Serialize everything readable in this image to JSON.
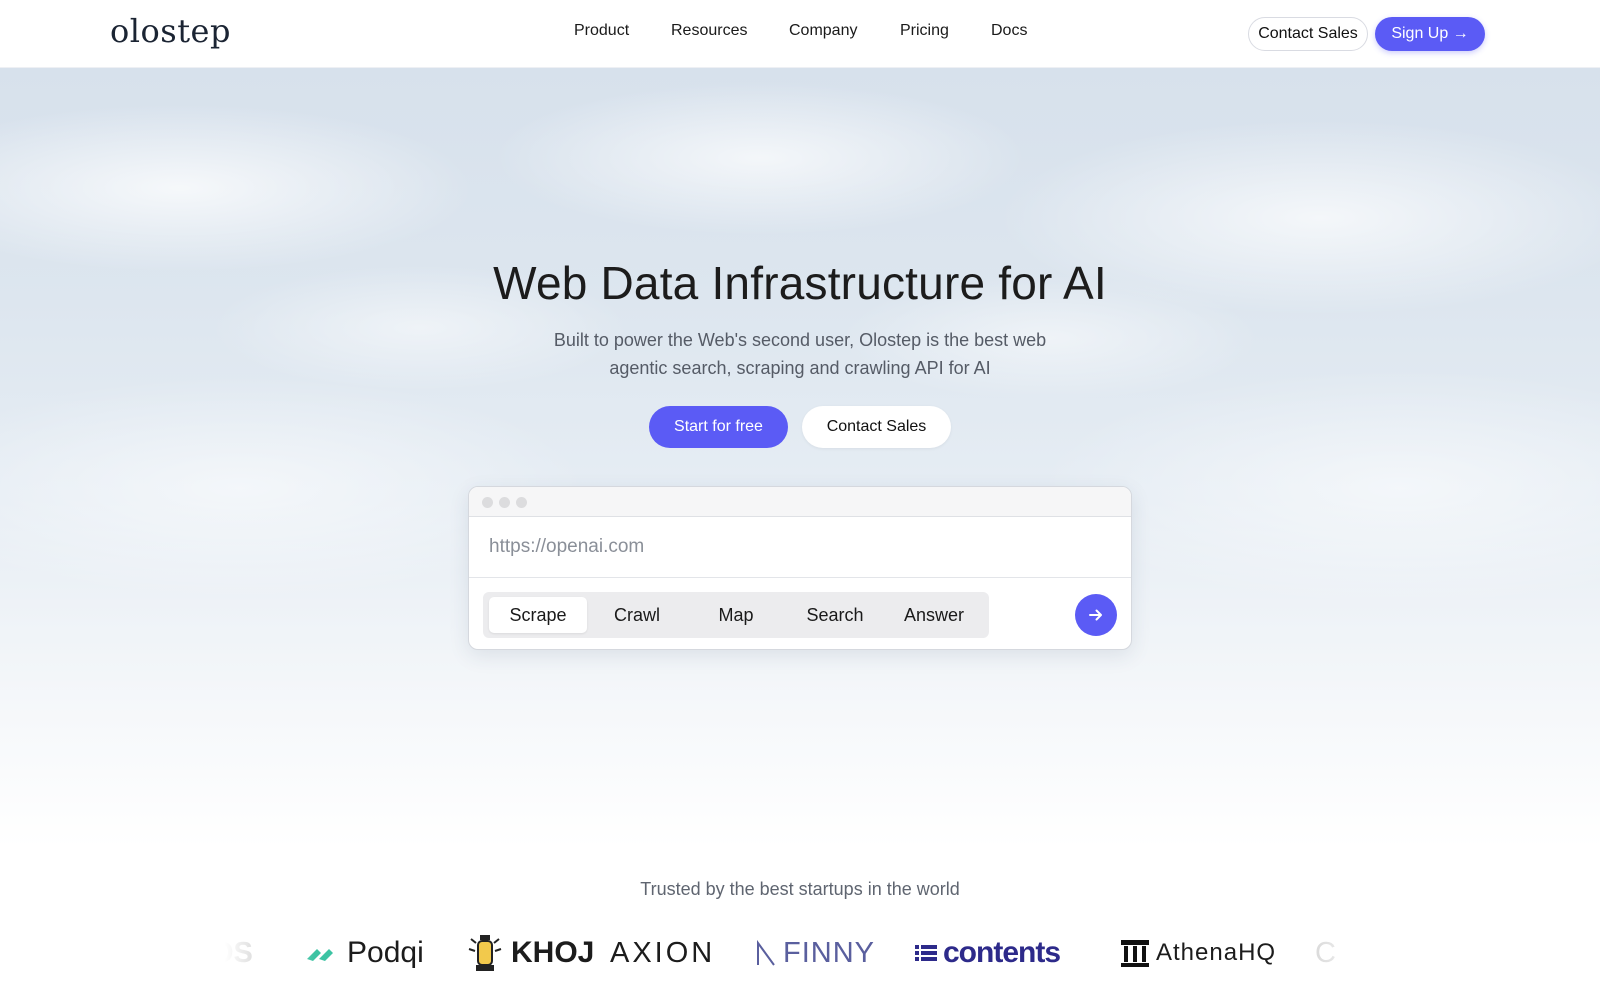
{
  "brand": {
    "name": "olostep"
  },
  "nav": {
    "items": [
      {
        "label": "Product"
      },
      {
        "label": "Resources"
      },
      {
        "label": "Company"
      },
      {
        "label": "Pricing"
      },
      {
        "label": "Docs"
      }
    ],
    "contact_sales": "Contact Sales",
    "sign_up": "Sign Up →"
  },
  "hero": {
    "title": "Web Data Infrastructure for AI",
    "subtitle": "Built to power the Web's second user, Olostep is the best web agentic search, scraping and crawling API for AI",
    "primary_cta": "Start for free",
    "secondary_cta": "Contact Sales"
  },
  "demo": {
    "url_placeholder": "https://openai.com",
    "url_value": "",
    "modes": [
      "Scrape",
      "Crawl",
      "Map",
      "Search",
      "Answer"
    ],
    "active_mode": "Scrape",
    "submit_icon": "arrow-right-icon"
  },
  "trusted": {
    "label": "Trusted by the best startups in the world",
    "logos": [
      {
        "name": "OS",
        "icon": "partial-logo-left"
      },
      {
        "name": "Podqi",
        "icon": "podqi-leaf-icon"
      },
      {
        "name": "KHOJ",
        "icon": "lantern-icon"
      },
      {
        "name": "AXION",
        "icon": ""
      },
      {
        "name": "FINNY",
        "icon": "finny-mark-icon"
      },
      {
        "name": "contents",
        "icon": "list-icon"
      },
      {
        "name": "AthenaHQ",
        "icon": "pillar-building-icon"
      },
      {
        "name": "C",
        "icon": "partial-logo-right"
      }
    ]
  },
  "colors": {
    "accent": "#5b5bf5",
    "text": "#1a1a1a",
    "muted": "#5f6570",
    "contents_brand": "#2d2a8a",
    "finny_brand": "#5a5f9e",
    "podqi_brand": "#3cc3a3"
  }
}
